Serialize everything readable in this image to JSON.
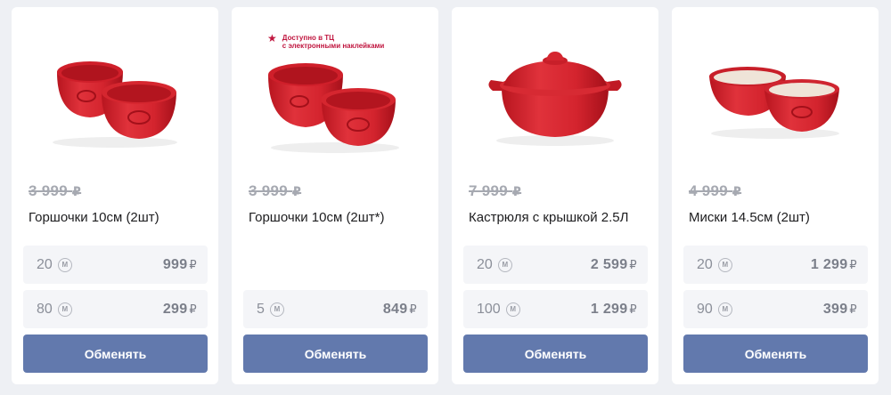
{
  "colors": {
    "button": "#6279ad",
    "product_red": "#d3232f",
    "promo": "#c0163f",
    "page_bg": "#eef0f4"
  },
  "rub": "₽",
  "coin_symbol": "M",
  "products": [
    {
      "image_icon": "two-red-ramekins-image",
      "old_price": "3 999",
      "name": "Горшочки 10см (2шт)",
      "options": [
        {
          "points": "20",
          "price": "999"
        },
        {
          "points": "80",
          "price": "299"
        }
      ],
      "button": "Обменять"
    },
    {
      "image_icon": "two-red-ramekins-image",
      "promo": "Доступно в ТЦ\nс электронными наклейками",
      "old_price": "3 999",
      "name": "Горшочки 10см (2шт*)",
      "options": [
        {
          "points": "5",
          "price": "849"
        }
      ],
      "button": "Обменять"
    },
    {
      "image_icon": "red-casserole-with-lid-image",
      "old_price": "7 999",
      "name": "Кастрюля с крышкой 2.5Л",
      "options": [
        {
          "points": "20",
          "price": "2 599"
        },
        {
          "points": "100",
          "price": "1 299"
        }
      ],
      "button": "Обменять"
    },
    {
      "image_icon": "two-red-bowls-image",
      "old_price": "4 999",
      "name": "Миски 14.5см (2шт)",
      "options": [
        {
          "points": "20",
          "price": "1 299"
        },
        {
          "points": "90",
          "price": "399"
        }
      ],
      "button": "Обменять"
    }
  ]
}
